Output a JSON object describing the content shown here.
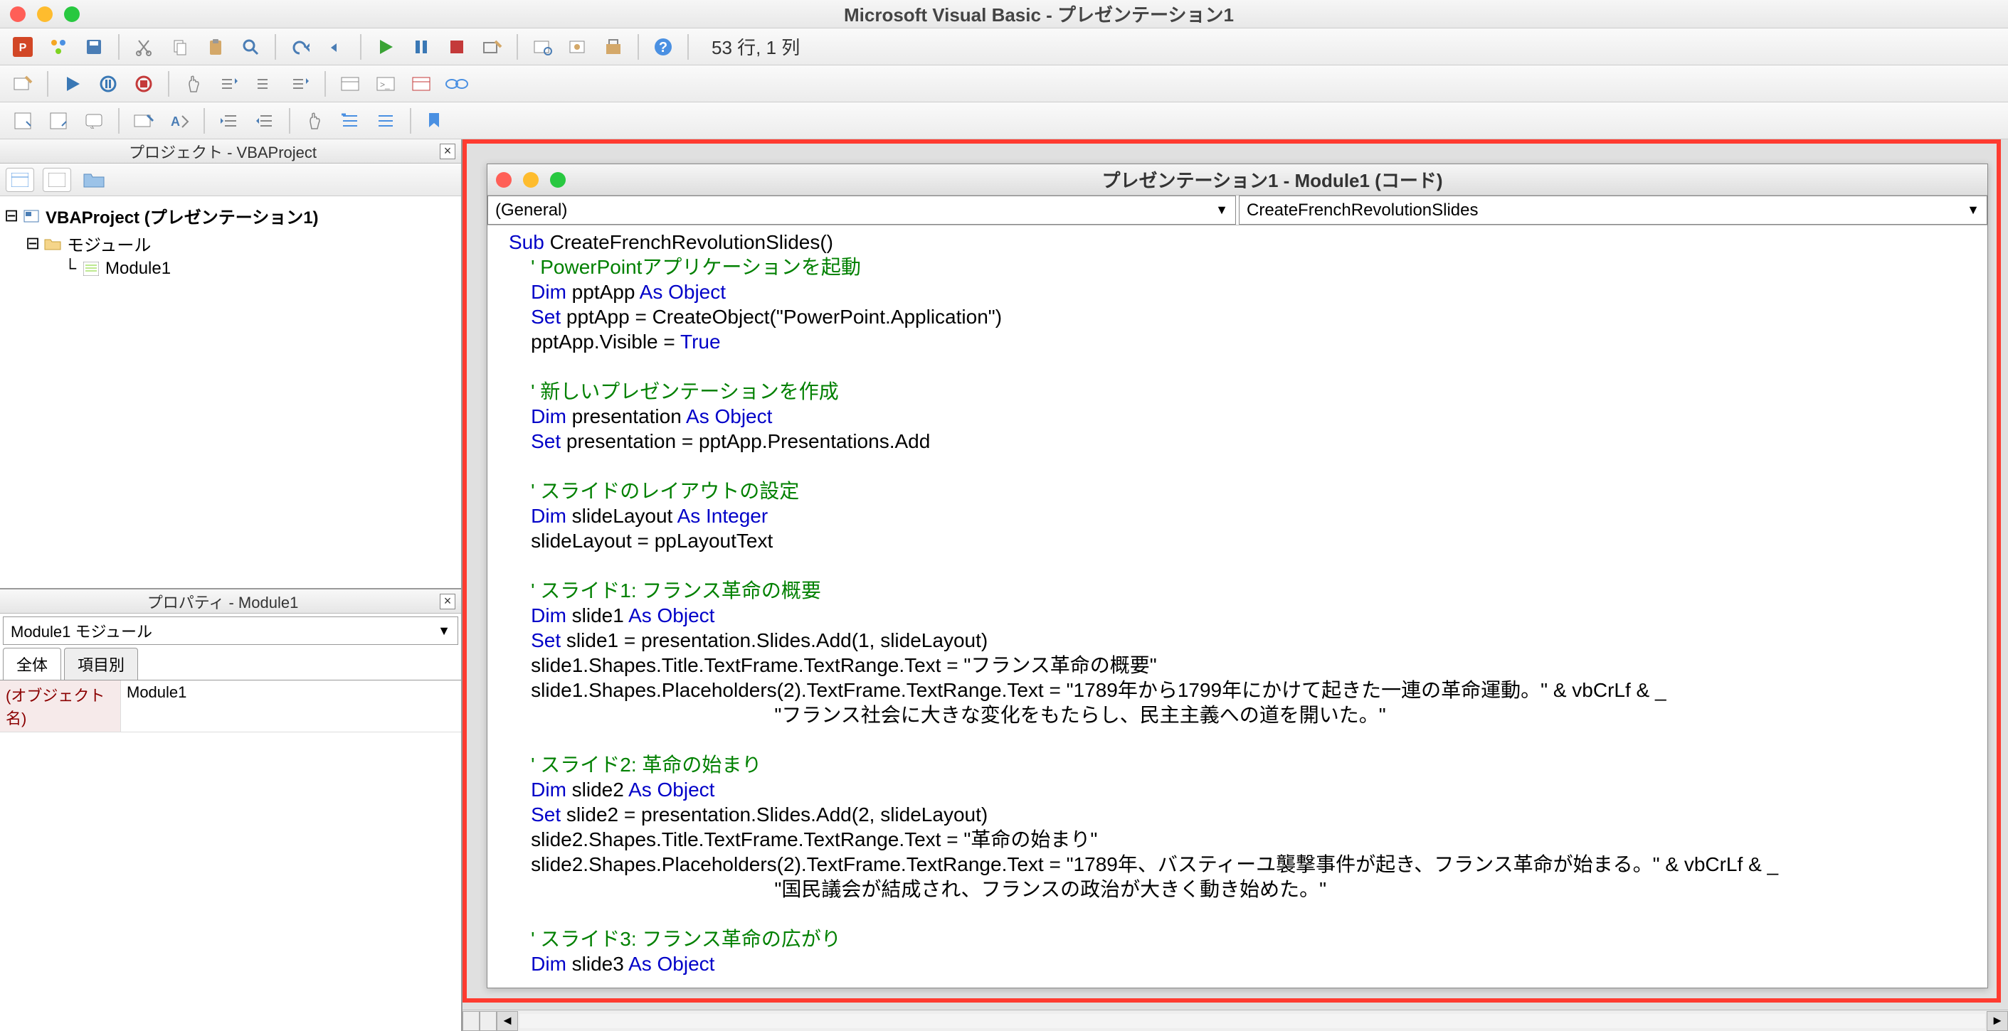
{
  "window": {
    "title": "Microsoft Visual Basic - プレゼンテーション1",
    "status": "53 行, 1 列"
  },
  "project_panel": {
    "title": "プロジェクト - VBAProject",
    "root": "VBAProject (プレゼンテーション1)",
    "folder": "モジュール",
    "module": "Module1"
  },
  "properties_panel": {
    "title": "プロパティ - Module1",
    "selector": "Module1 モジュール",
    "tab_all": "全体",
    "tab_cat": "項目別",
    "rows": [
      {
        "key": "(オブジェクト名)",
        "val": "Module1"
      }
    ]
  },
  "code_window": {
    "title": "プレゼンテーション1 - Module1 (コード)",
    "object_dd": "(General)",
    "proc_dd": "CreateFrenchRevolutionSlides"
  },
  "code_lines": [
    {
      "i": 0,
      "seg": [
        {
          "t": "Sub",
          "c": "kw"
        },
        {
          "t": " CreateFrenchRevolutionSlides()"
        }
      ]
    },
    {
      "i": 1,
      "seg": [
        {
          "t": "' PowerPointアプリケーションを起動",
          "c": "cm"
        }
      ]
    },
    {
      "i": 1,
      "seg": [
        {
          "t": "Dim",
          "c": "kw"
        },
        {
          "t": " pptApp "
        },
        {
          "t": "As Object",
          "c": "kw"
        }
      ]
    },
    {
      "i": 1,
      "seg": [
        {
          "t": "Set",
          "c": "kw"
        },
        {
          "t": " pptApp = CreateObject(\"PowerPoint.Application\")"
        }
      ]
    },
    {
      "i": 1,
      "seg": [
        {
          "t": "pptApp.Visible = "
        },
        {
          "t": "True",
          "c": "kw"
        }
      ]
    },
    {
      "i": 1,
      "seg": [
        {
          "t": ""
        }
      ]
    },
    {
      "i": 1,
      "seg": [
        {
          "t": "' 新しいプレゼンテーションを作成",
          "c": "cm"
        }
      ]
    },
    {
      "i": 1,
      "seg": [
        {
          "t": "Dim",
          "c": "kw"
        },
        {
          "t": " presentation "
        },
        {
          "t": "As Object",
          "c": "kw"
        }
      ]
    },
    {
      "i": 1,
      "seg": [
        {
          "t": "Set",
          "c": "kw"
        },
        {
          "t": " presentation = pptApp.Presentations.Add"
        }
      ]
    },
    {
      "i": 1,
      "seg": [
        {
          "t": ""
        }
      ]
    },
    {
      "i": 1,
      "seg": [
        {
          "t": "' スライドのレイアウトの設定",
          "c": "cm"
        }
      ]
    },
    {
      "i": 1,
      "seg": [
        {
          "t": "Dim",
          "c": "kw"
        },
        {
          "t": " slideLayout "
        },
        {
          "t": "As Integer",
          "c": "kw"
        }
      ]
    },
    {
      "i": 1,
      "seg": [
        {
          "t": "slideLayout = ppLayoutText"
        }
      ]
    },
    {
      "i": 1,
      "seg": [
        {
          "t": ""
        }
      ]
    },
    {
      "i": 1,
      "seg": [
        {
          "t": "' スライド1: フランス革命の概要",
          "c": "cm"
        }
      ]
    },
    {
      "i": 1,
      "seg": [
        {
          "t": "Dim",
          "c": "kw"
        },
        {
          "t": " slide1 "
        },
        {
          "t": "As Object",
          "c": "kw"
        }
      ]
    },
    {
      "i": 1,
      "seg": [
        {
          "t": "Set",
          "c": "kw"
        },
        {
          "t": " slide1 = presentation.Slides.Add(1, slideLayout)"
        }
      ]
    },
    {
      "i": 1,
      "seg": [
        {
          "t": "slide1.Shapes.Title.TextFrame.TextRange.Text = \"フランス革命の概要\""
        }
      ]
    },
    {
      "i": 1,
      "seg": [
        {
          "t": "slide1.Shapes.Placeholders(2).TextFrame.TextRange.Text = \"1789年から1799年にかけて起きた一連の革命運動。\" & vbCrLf & _"
        }
      ]
    },
    {
      "i": 12,
      "seg": [
        {
          "t": "\"フランス社会に大きな変化をもたらし、民主主義への道を開いた。\""
        }
      ]
    },
    {
      "i": 1,
      "seg": [
        {
          "t": ""
        }
      ]
    },
    {
      "i": 1,
      "seg": [
        {
          "t": "' スライド2: 革命の始まり",
          "c": "cm"
        }
      ]
    },
    {
      "i": 1,
      "seg": [
        {
          "t": "Dim",
          "c": "kw"
        },
        {
          "t": " slide2 "
        },
        {
          "t": "As Object",
          "c": "kw"
        }
      ]
    },
    {
      "i": 1,
      "seg": [
        {
          "t": "Set",
          "c": "kw"
        },
        {
          "t": " slide2 = presentation.Slides.Add(2, slideLayout)"
        }
      ]
    },
    {
      "i": 1,
      "seg": [
        {
          "t": "slide2.Shapes.Title.TextFrame.TextRange.Text = \"革命の始まり\""
        }
      ]
    },
    {
      "i": 1,
      "seg": [
        {
          "t": "slide2.Shapes.Placeholders(2).TextFrame.TextRange.Text = \"1789年、バスティーユ襲撃事件が起き、フランス革命が始まる。\" & vbCrLf & _"
        }
      ]
    },
    {
      "i": 12,
      "seg": [
        {
          "t": "\"国民議会が結成され、フランスの政治が大きく動き始めた。\""
        }
      ]
    },
    {
      "i": 1,
      "seg": [
        {
          "t": ""
        }
      ]
    },
    {
      "i": 1,
      "seg": [
        {
          "t": "' スライド3: フランス革命の広がり",
          "c": "cm"
        }
      ]
    },
    {
      "i": 1,
      "seg": [
        {
          "t": "Dim",
          "c": "kw"
        },
        {
          "t": " slide3 "
        },
        {
          "t": "As Object",
          "c": "kw"
        }
      ]
    }
  ]
}
